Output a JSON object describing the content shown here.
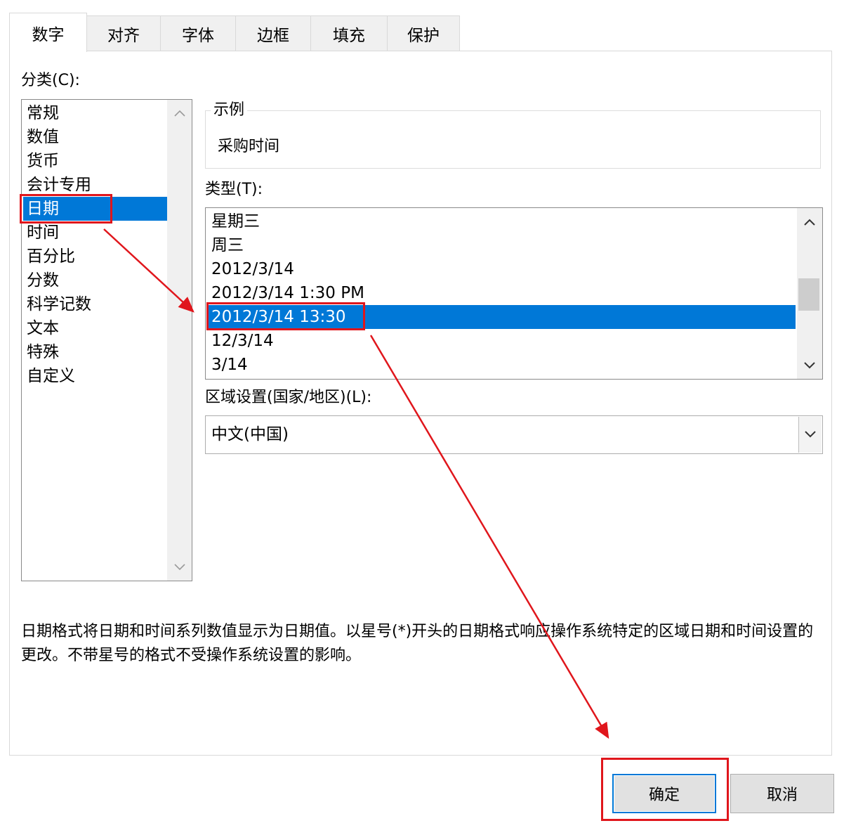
{
  "tabs": [
    "数字",
    "对齐",
    "字体",
    "边框",
    "填充",
    "保护"
  ],
  "active_tab": "数字",
  "category_label": "分类(C):",
  "categories": [
    "常规",
    "数值",
    "货币",
    "会计专用",
    "日期",
    "时间",
    "百分比",
    "分数",
    "科学记数",
    "文本",
    "特殊",
    "自定义"
  ],
  "selected_category": "日期",
  "sample": {
    "label": "示例",
    "value": "采购时间"
  },
  "type_label": "类型(T):",
  "types": [
    "星期三",
    "周三",
    "2012/3/14",
    "2012/3/14 1:30 PM",
    "2012/3/14 13:30",
    "12/3/14",
    "3/14"
  ],
  "selected_type": "2012/3/14 13:30",
  "locale": {
    "label": "区域设置(国家/地区)(L):",
    "value": "中文(中国)"
  },
  "description": "日期格式将日期和时间系列数值显示为日期值。以星号(*)开头的日期格式响应操作系统特定的区域日期和时间设置的更改。不带星号的格式不受操作系统设置的影响。",
  "buttons": {
    "ok": "确定",
    "cancel": "取消"
  },
  "colors": {
    "selection": "#0078d7",
    "annotation": "#e0161c"
  }
}
